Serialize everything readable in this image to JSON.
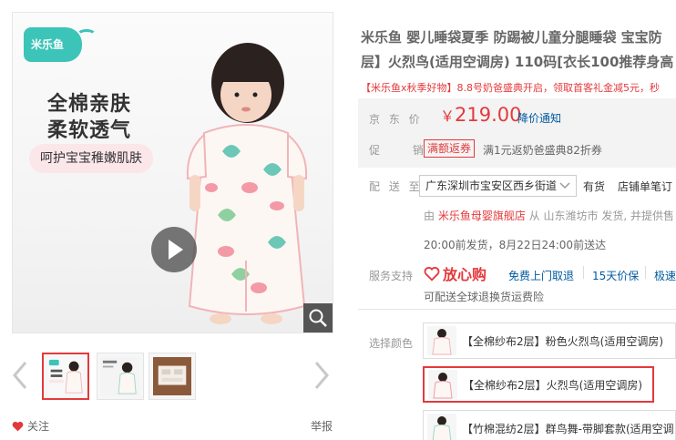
{
  "gallery": {
    "brand_logo": "米乐鱼",
    "promo_line1": "全棉亲肤",
    "promo_line2": "柔软透气",
    "promo_tag": "呵护宝宝稚嫩肌肤",
    "thumbnails": [
      {
        "active": true
      },
      {
        "active": false
      },
      {
        "active": false
      }
    ],
    "follow_label": "关注",
    "report_label": "举报"
  },
  "product": {
    "title_line1": "米乐鱼 婴儿睡袋夏季 防踢被儿童分腿睡袋 宝宝防",
    "title_line2": "层】火烈鸟(适用空调房) 110码[衣长100推荐身高",
    "subtitle": "【米乐鱼x秋季好物】8.8号奶爸盛典开启，领取首客礼金减5元，秒"
  },
  "price": {
    "label": "京 东 价",
    "currency": "￥",
    "value": "219.00",
    "notify_label": "降价通知"
  },
  "promotion": {
    "label": "促 销",
    "badge": "满额返券",
    "text": "满1元返奶爸盛典82折券"
  },
  "delivery": {
    "label": "配 送 至",
    "address": "广东深圳市宝安区西乡街道",
    "stock": "有货",
    "reason": "店铺单笔订",
    "ship_prefix": "由",
    "shop_name": "米乐鱼母婴旗舰店",
    "ship_from": "从 山东潍坊市 发货, 并提供售",
    "arrive_text": "20:00前发货，8月22日24:00前送达"
  },
  "service": {
    "label": "服务支持",
    "fxg": "放心购",
    "items": [
      "免费上门取退",
      "15天价保",
      "极速"
    ],
    "global_text": "可配送全球退换货运费险"
  },
  "colors": {
    "label": "选择颜色",
    "options": [
      {
        "name": "【全棉纱布2层】粉色火烈鸟(适用空调房)",
        "selected": false
      },
      {
        "name": "【全棉纱布2层】火烈鸟(适用空调房)",
        "selected": true
      },
      {
        "name": "【竹棉混纺2层】群鸟舞-带脚套款(适用空调"
      }
    ]
  },
  "theme": {
    "accent": "#e4393c",
    "link": "#005aa0",
    "brand": "#3cc4b8"
  }
}
